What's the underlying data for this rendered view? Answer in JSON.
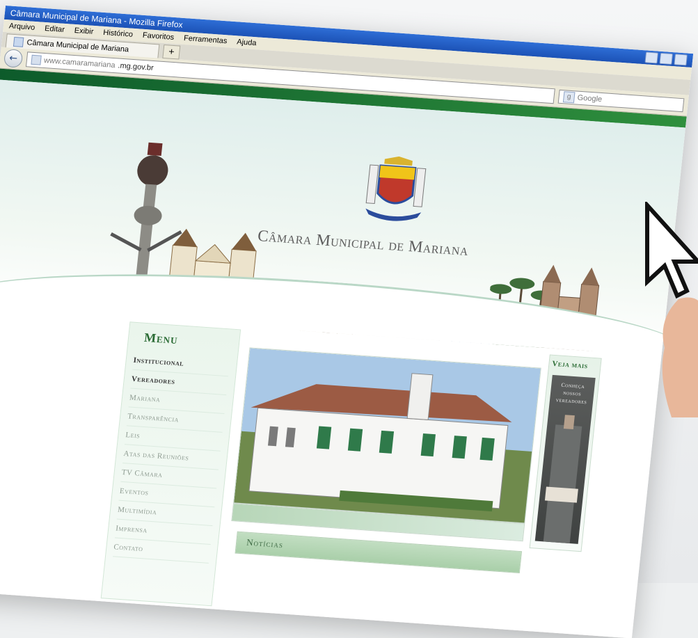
{
  "browser": {
    "window_title": "Câmara Municipal de Mariana - Mozilla Firefox",
    "menu": [
      "Arquivo",
      "Editar",
      "Exibir",
      "Histórico",
      "Favoritos",
      "Ferramentas",
      "Ajuda"
    ],
    "tab_title": "Câmara Municipal de Mariana",
    "new_tab": "+",
    "url_dim": "www.camaramariana",
    "url_strong": ".mg.gov.br",
    "search_placeholder": "Google"
  },
  "site": {
    "title": "Câmara Municipal de Mariana",
    "menu_heading": "Menu",
    "menu_items": [
      "Institucional",
      "Vereadores",
      "Mariana",
      "Transparência",
      "Leis",
      "Atas das Reuniões",
      "TV Câmara",
      "Eventos",
      "Multimídia",
      "Imprensa",
      "Contato"
    ],
    "active_items": [
      "Institucional",
      "Vereadores"
    ],
    "side_heading": "Veja mais",
    "side_card": [
      "Conheça",
      "nossos",
      "vereadores"
    ],
    "news_label": "Notícias"
  },
  "colors": {
    "brand_green": "#0d5b2b",
    "light_green": "#b9d7c6",
    "menu_text": "#8e9b91",
    "titlebar_blue": "#2e6ed6"
  },
  "icons": [
    "back-arrow-icon",
    "site-favicon",
    "search-engine-icon",
    "cursor-pointer-icon"
  ]
}
